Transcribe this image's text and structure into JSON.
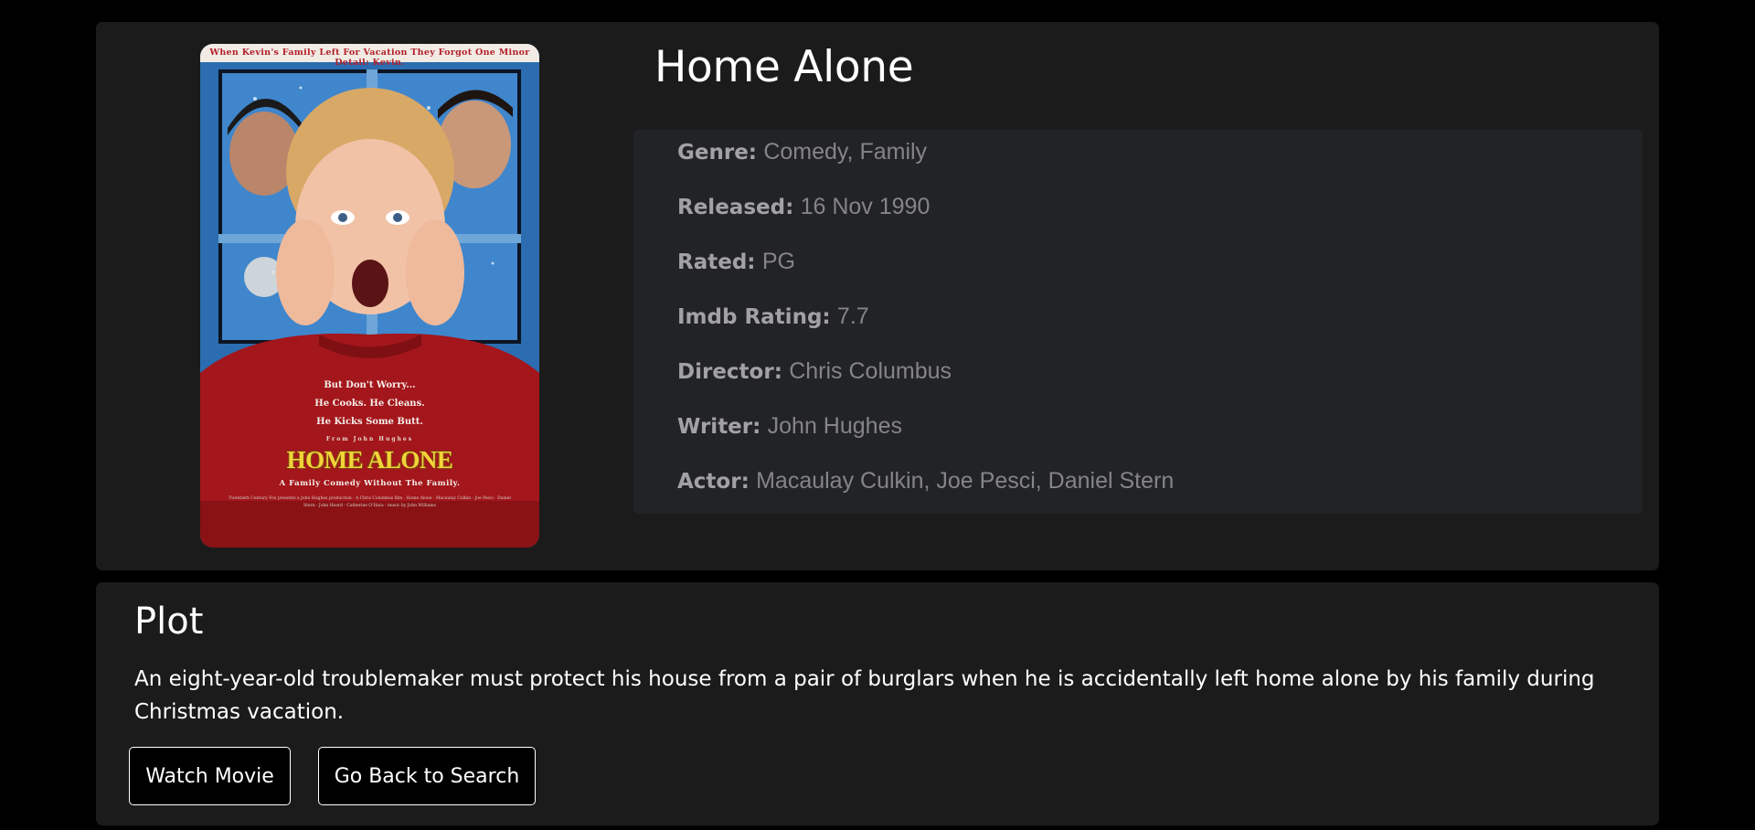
{
  "movie": {
    "title": "Home Alone",
    "poster": {
      "tagline": "When Kevin's Family Left For Vacation They Forgot One Minor Detail: Kevin.",
      "worry_text": "But Don't Worry...\nHe Cooks.  He Cleans.\nHe Kicks Some Butt.",
      "from_text": "From John Hughes",
      "logo": "HOME ALONE",
      "subtitle": "A Family Comedy Without The Family.",
      "credits": "Twentieth Century Fox presents a John Hughes production · A Chris Columbus film · Home Alone · Macaulay Culkin · Joe Pesci · Daniel Stern · John Heard · Catherine O'Hara · music by John Williams",
      "colors": {
        "sky": "#1a4f86",
        "sweater": "#a3161b",
        "logo": "#f2d33a"
      }
    },
    "details": [
      {
        "key": "Genre:",
        "value": "Comedy, Family"
      },
      {
        "key": "Released:",
        "value": "16 Nov 1990"
      },
      {
        "key": "Rated:",
        "value": "PG"
      },
      {
        "key": "Imdb Rating:",
        "value": "7.7"
      },
      {
        "key": "Director:",
        "value": "Chris Columbus"
      },
      {
        "key": "Writer:",
        "value": "John Hughes"
      },
      {
        "key": "Actor:",
        "value": "Macaulay Culkin, Joe Pesci, Daniel Stern"
      }
    ]
  },
  "plot": {
    "heading": "Plot",
    "text": "An eight-year-old troublemaker must protect his house from a pair of burglars when he is accidentally left home alone by his family during Christmas vacation."
  },
  "actions": {
    "watch_label": "Watch Movie",
    "back_label": "Go Back to Search"
  },
  "theme": {
    "background": "#000000",
    "card": "#1b1b1c",
    "details_panel": "#222326",
    "text": "#ffffff",
    "muted_text": "#858587"
  }
}
